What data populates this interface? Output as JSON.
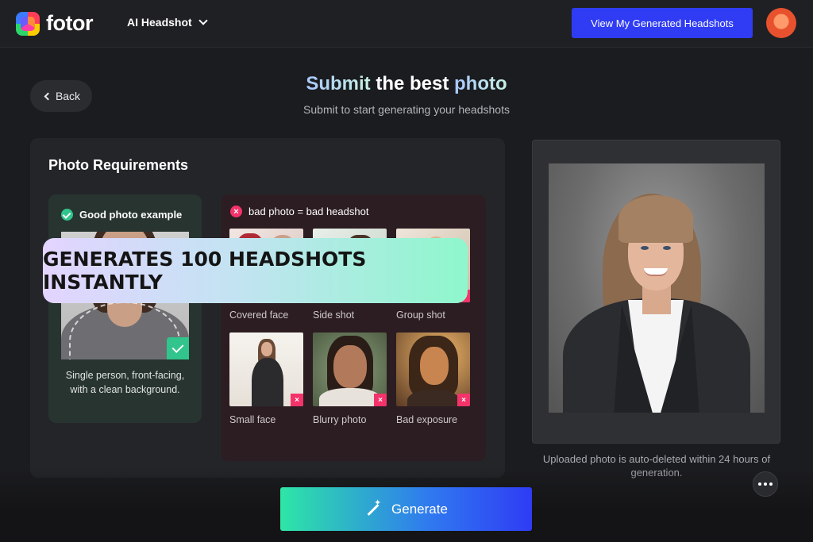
{
  "header": {
    "brand": "fotor",
    "nav_label": "AI Headshot",
    "view_button": "View My Generated Headshots"
  },
  "page": {
    "back_label": "Back",
    "title_part1": "Submit",
    "title_part2": "the best",
    "title_part3": "photo",
    "subtitle": "Submit to start generating your headshots"
  },
  "requirements": {
    "title": "Photo Requirements",
    "good": {
      "title": "Good photo example",
      "description": "Single person, front-facing, with a clean background."
    },
    "bad": {
      "title": "bad photo = bad headshot",
      "items": [
        {
          "label": "Covered face"
        },
        {
          "label": "Side shot"
        },
        {
          "label": "Group shot"
        },
        {
          "label": "Small face"
        },
        {
          "label": "Blurry photo"
        },
        {
          "label": "Bad exposure"
        }
      ]
    }
  },
  "preview": {
    "note": "Uploaded photo is auto-deleted within 24 hours of generation."
  },
  "actions": {
    "generate": "Generate"
  },
  "promo": {
    "text": "GENERATES 100 HEADSHOTS INSTANTLY"
  },
  "colors": {
    "accent_blue": "#2f3cf4",
    "success_green": "#31c48d",
    "error_pink": "#f4336b"
  }
}
